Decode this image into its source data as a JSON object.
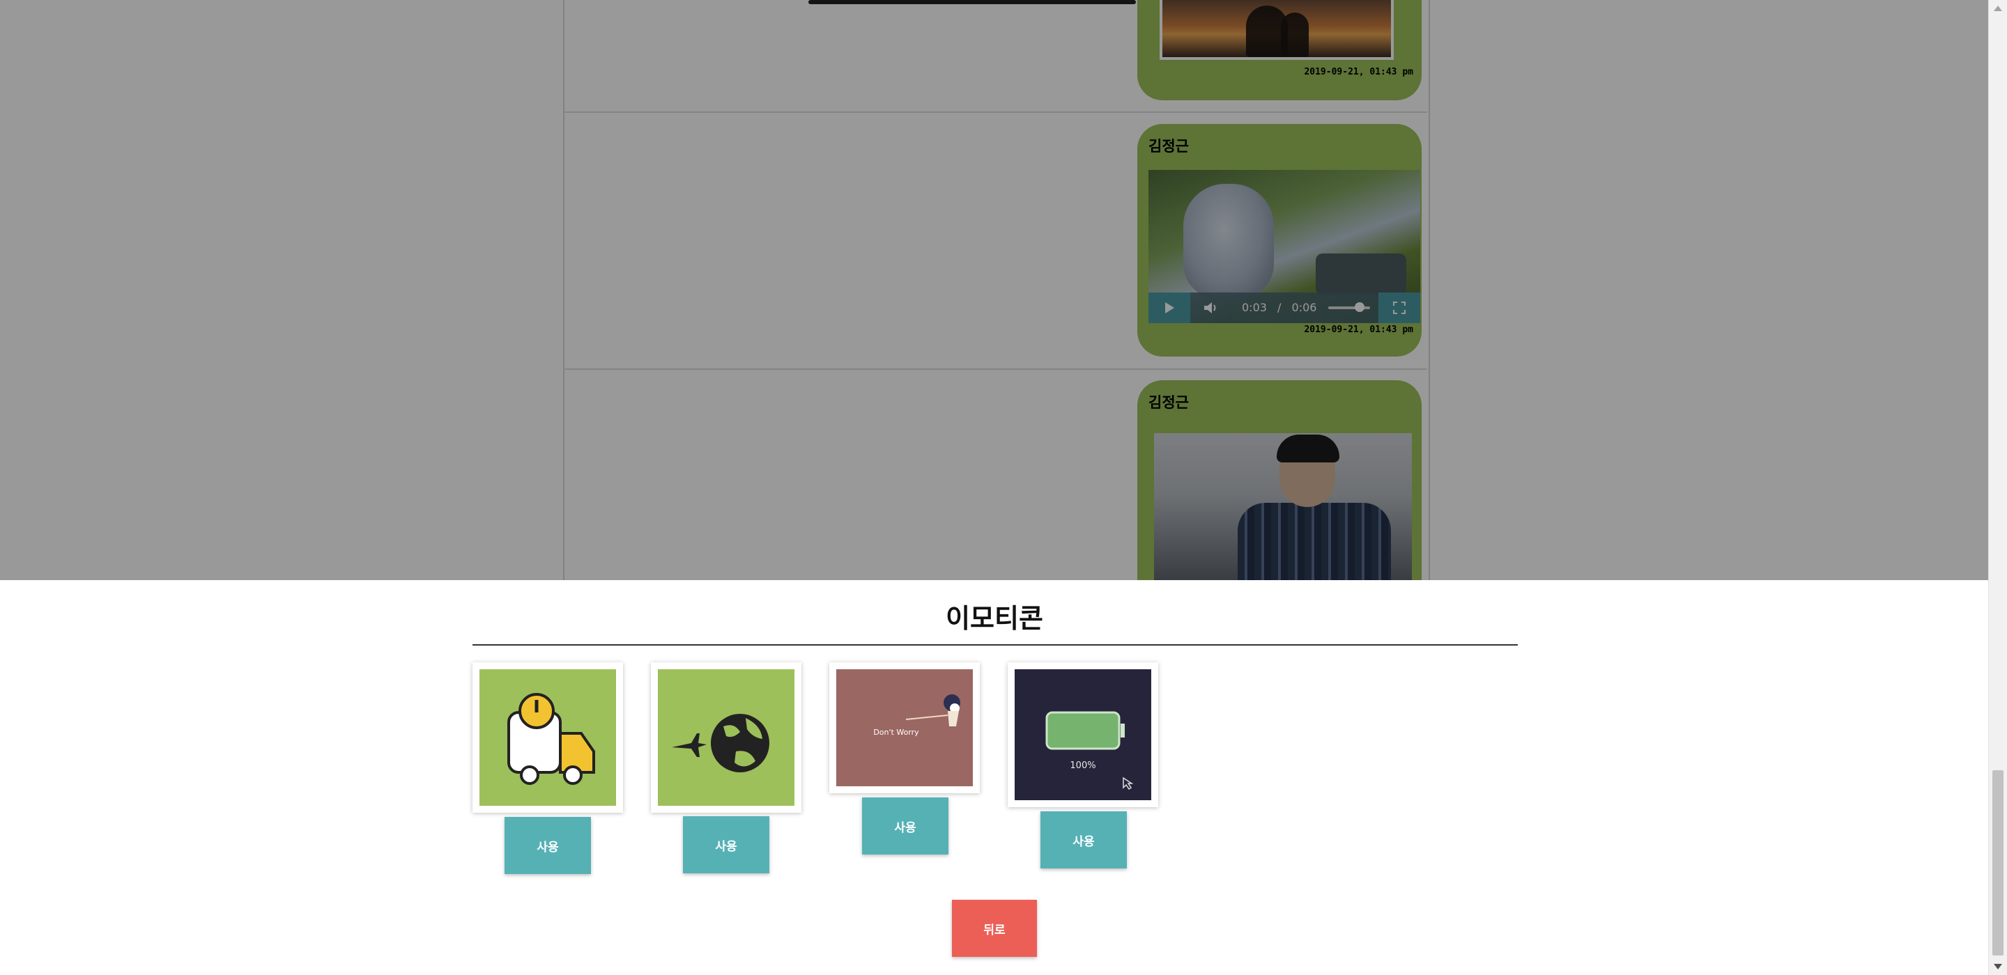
{
  "chat": {
    "messages": [
      {
        "sender": "",
        "timestamp": "2019-09-21, 01:43 pm",
        "kind": "photo"
      },
      {
        "sender": "김정근",
        "timestamp": "2019-09-21, 01:43 pm",
        "kind": "video",
        "video": {
          "current_time": "0:03",
          "separator": "/",
          "duration": "0:06",
          "volume_fraction": 0.7
        }
      },
      {
        "sender": "김정근",
        "timestamp": "",
        "kind": "photo"
      }
    ]
  },
  "emoticon_panel": {
    "title": "이모티콘",
    "items": [
      {
        "name": "delivery-truck-emoticon",
        "use_label": "사용",
        "bg": "#9dc05a"
      },
      {
        "name": "airplane-globe-emoticon",
        "use_label": "사용",
        "bg": "#9dc05a"
      },
      {
        "name": "dont-worry-emoticon",
        "use_label": "사용",
        "bg": "#9a6762",
        "caption": "Don't Worry"
      },
      {
        "name": "battery-full-emoticon",
        "use_label": "사용",
        "bg": "#26243a",
        "caption": "100%"
      }
    ],
    "back_label": "뒤로"
  },
  "colors": {
    "bubble": "#9dc05a",
    "use_button": "#56b1b5",
    "back_button": "#ec5f57"
  }
}
